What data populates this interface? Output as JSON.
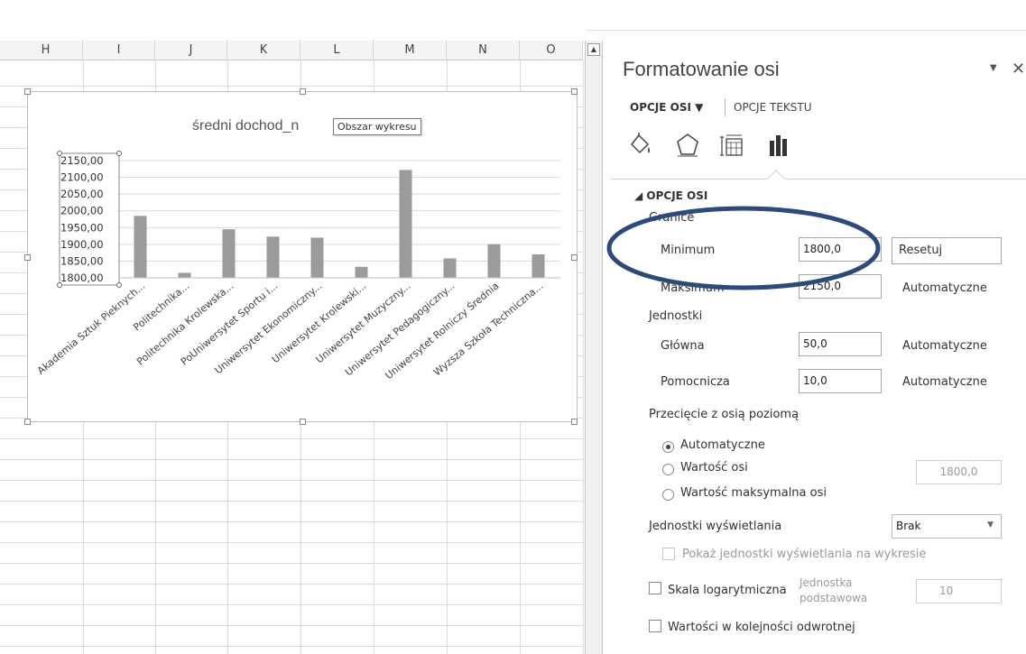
{
  "sheet": {
    "columns": [
      "H",
      "I",
      "J",
      "K",
      "L",
      "M",
      "N",
      "O"
    ]
  },
  "chart": {
    "tooltip": "Obszar wykresu"
  },
  "chart_data": {
    "type": "bar",
    "title": "średni dochod_n",
    "categories": [
      "Akademia Sztuk Pieknych...",
      "Politechnika...",
      "Politechnika Krolewska...",
      "PoUniwersytet Sportu i...",
      "Uniwersytet Ekonomiczny...",
      "Uniwersytet Krolewski...",
      "Uniwersytet Muzyczny...",
      "Uniwersytet Pedagogiczny...",
      "Uniwersytet Rolniczy Średnia",
      "Wyzsza Szkoła Techniczna..."
    ],
    "series": [
      {
        "values": [
          1985,
          1815,
          1945,
          1923,
          1920,
          1833,
          2122,
          1858,
          1900,
          1870
        ]
      }
    ],
    "ylim": [
      1800,
      2150
    ],
    "yticks": [
      "1800,00",
      "1850,00",
      "1900,00",
      "1950,00",
      "2000,00",
      "2050,00",
      "2100,00",
      "2150,00"
    ],
    "xlabel": "",
    "ylabel": "",
    "grid": true,
    "bar_color": "#9b9b9b"
  },
  "panel": {
    "title": "Formatowanie osi",
    "menu_glyph": "▼",
    "close_glyph": "✕",
    "tab_axis": "OPCJE OSI ▼",
    "tab_text": "OPCJE TEKSTU",
    "section": "◢ OPCJE OSI",
    "bounds_heading": "Granice",
    "min_label": "Minimum",
    "min_value": "1800,0",
    "reset_button": "Resetuj",
    "max_label": "Maksimum",
    "max_value": "2150,0",
    "max_auto": "Automatyczne",
    "units_heading": "Jednostki",
    "major_label": "Główna",
    "major_value": "50,0",
    "major_auto": "Automatyczne",
    "minor_label": "Pomocnicza",
    "minor_value": "10,0",
    "minor_auto": "Automatyczne",
    "cross_heading": "Przecięcie z osią poziomą",
    "radio_auto": "Automatyczne",
    "radio_axis_value": "Wartość osi",
    "axis_value": "1800,0",
    "radio_max": "Wartość maksymalna osi",
    "display_units_label": "Jednostki wyświetlania",
    "display_units_value": "Brak",
    "show_units_label": "Pokaż jednostki wyświetlania na wykresie",
    "log_label": "Skala logarytmiczna",
    "log_base_label_1": "Jednostka",
    "log_base_label_2": "podstawowa",
    "log_base_value": "10",
    "reverse_label": "Wartości w kolejności odwrotnej",
    "accent_ellipse": "#2e4a7a"
  }
}
